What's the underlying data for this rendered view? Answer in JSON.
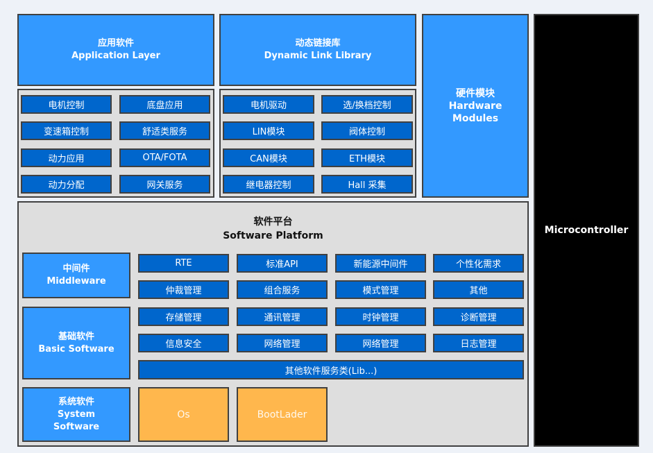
{
  "application_layer": {
    "title_cn": "应用软件",
    "title_en": "Application Layer",
    "items": [
      "电机控制",
      "底盘应用",
      "变速箱控制",
      "舒适类服务",
      "动力应用",
      "OTA/FOTA",
      "动力分配",
      "网关服务"
    ]
  },
  "dll": {
    "title_cn": "动态链接库",
    "title_en": "Dynamic Link Library",
    "items": [
      "电机驱动",
      "选/换档控制",
      "LIN模块",
      "阀体控制",
      "CAN模块",
      "ETH模块",
      "继电器控制",
      "Hall 采集"
    ]
  },
  "hardware": {
    "title_cn": "硬件模块",
    "title_en1": "Hardware",
    "title_en2": "Modules"
  },
  "microcontroller": {
    "label": "Microcontroller"
  },
  "platform": {
    "title_cn": "软件平台",
    "title_en": "Software Platform",
    "middleware": {
      "cn": "中间件",
      "en": "Middleware"
    },
    "basic": {
      "cn": "基础软件",
      "en": "Basic Software"
    },
    "system": {
      "cn": "系统软件",
      "en1": "System",
      "en2": "Software"
    },
    "grid": [
      "RTE",
      "标准API",
      "新能源中间件",
      "个性化需求",
      "仲裁管理",
      "组合服务",
      "模式管理",
      "其他",
      "存储管理",
      "通讯管理",
      "时钟管理",
      "诊断管理",
      "信息安全",
      "网络管理",
      "网络管理",
      "日志管理"
    ],
    "lib": "其他软件服务类(Lib...)",
    "os": "Os",
    "bootloader": "BootLader"
  },
  "colors": {
    "light_blue": "#3399ff",
    "dark_blue": "#0066cc",
    "orange": "#ffb74d",
    "panel": "#dedede",
    "micro": "#000000"
  }
}
